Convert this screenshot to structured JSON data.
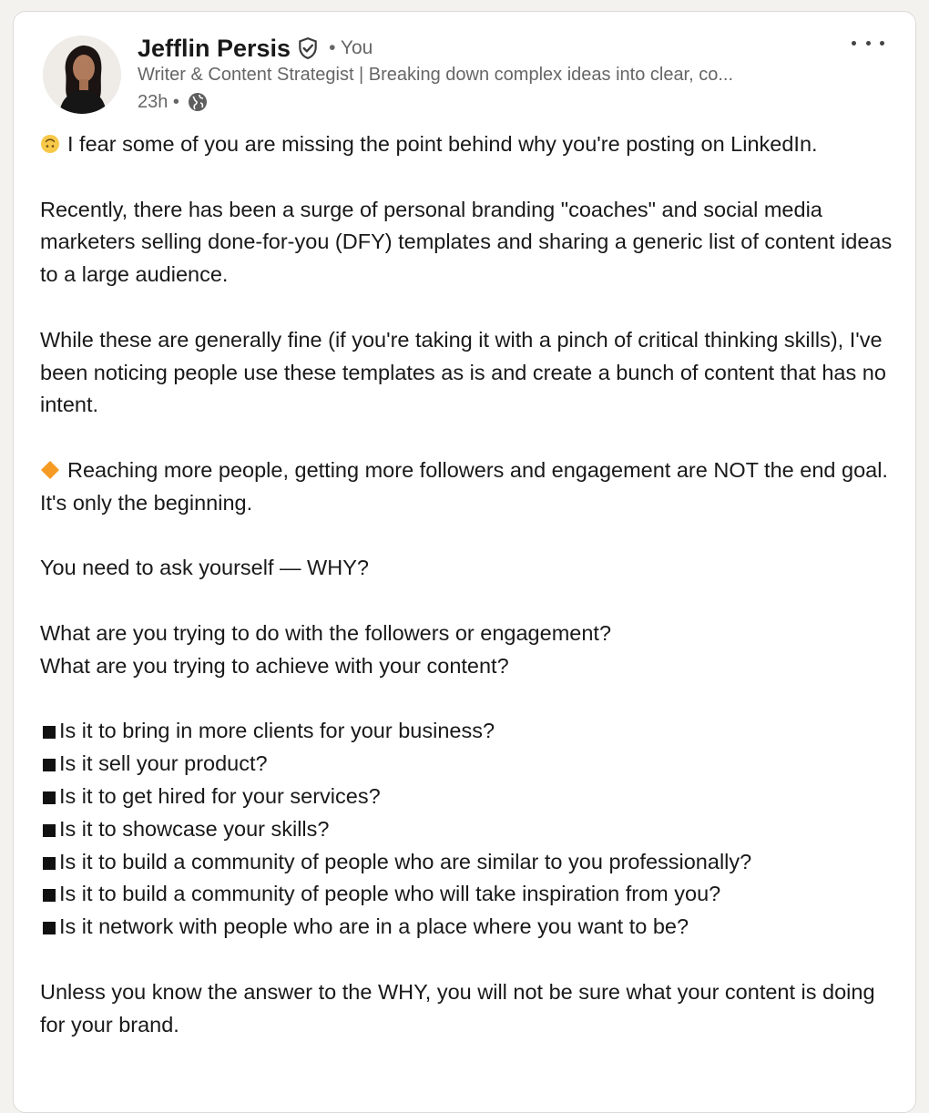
{
  "post": {
    "author_name": "Jefflin Persis",
    "you_label": "• You",
    "headline": "Writer & Content Strategist | Breaking down complex ideas into clear, co...",
    "time": "23h •",
    "icons": {
      "verified": "verified-shield-icon",
      "visibility": "globe-icon",
      "more": "more-options-icon",
      "emoji_1": "upside-down-face-emoji",
      "emoji_2": "orange-diamond-emoji",
      "bullet": "black-square-bullet"
    },
    "paragraphs": [
      "I fear some of you are missing the point behind why you're posting on LinkedIn.",
      "Recently, there has been a surge of personal branding \"coaches\" and social media marketers selling done-for-you (DFY) templates and sharing a generic list of content ideas to a large audience.",
      "While these are generally fine (if you're taking it with a pinch of critical thinking skills), I've been noticing people use these templates as is and create a bunch of content that has no intent.",
      "Reaching more people, getting more followers and engagement are NOT the end goal. It's only the beginning.",
      "You need to ask yourself — WHY?",
      "What are you trying to do with the followers or engagement?",
      "What are you trying to achieve with your content?"
    ],
    "bullets": [
      "Is it to bring in more clients for your business?",
      "Is it sell your product?",
      "Is it to get hired for your services?",
      "Is it to showcase your skills?",
      "Is it to build a community of people who are similar to you professionally?",
      "Is it to build a community of people who will take inspiration from you?",
      "Is it network with people who are in a place where you want to be?"
    ],
    "closing": "Unless you know the answer to the WHY, you will not be sure what your content is doing for your brand."
  },
  "colors": {
    "background": "#f4f2ee",
    "card": "#ffffff",
    "text": "#191919",
    "muted": "#666666",
    "emoji_yellow": "#f7c948",
    "emoji_orange": "#f59a23"
  }
}
